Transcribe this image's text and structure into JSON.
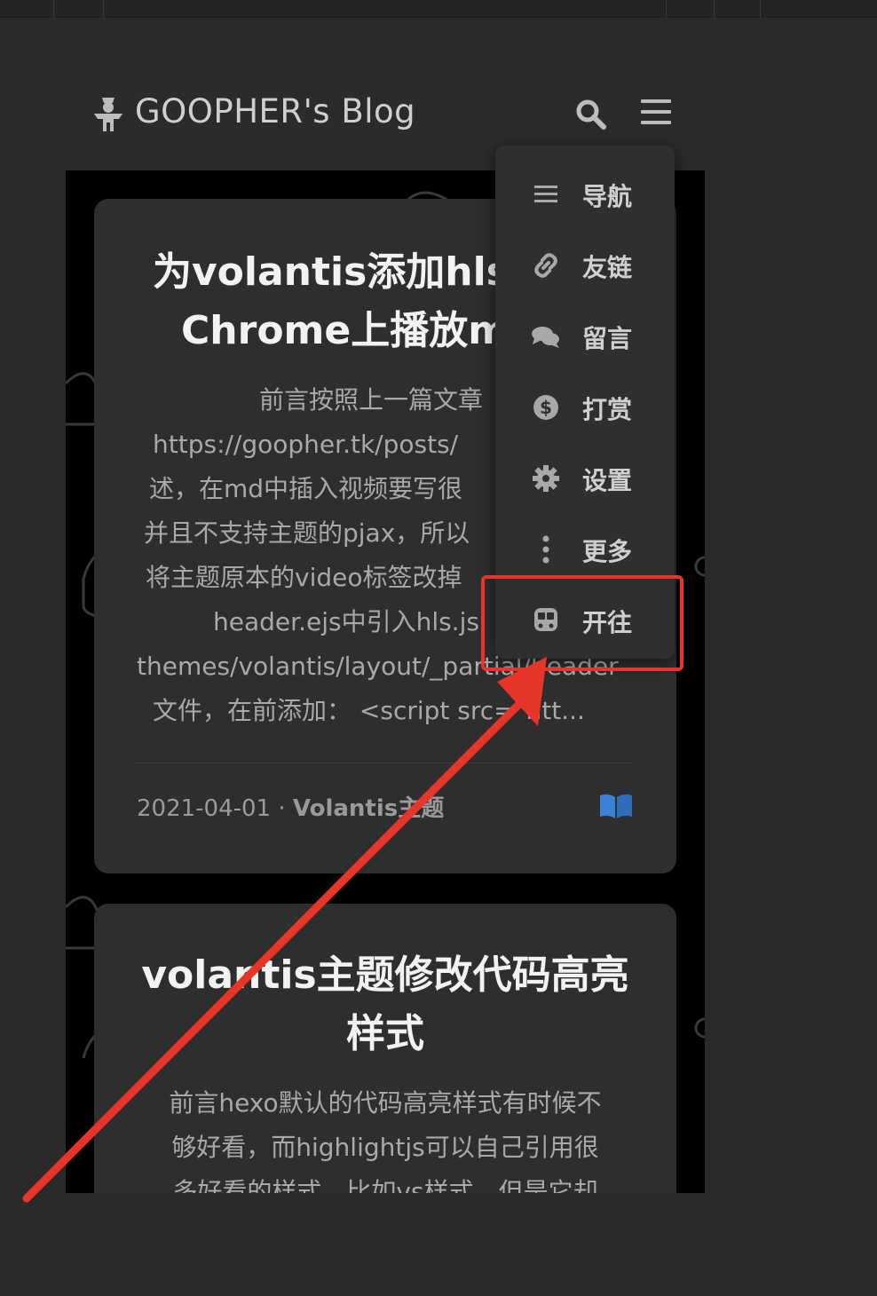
{
  "header": {
    "site_title": "GOOPHER's Blog",
    "logo_icon": "scarecrow-logo-icon",
    "search_icon": "search-icon",
    "menu_icon": "hamburger-menu-icon"
  },
  "posts": [
    {
      "title_lines": [
        "为volantis添加hls.js支持",
        "Chrome上播放m3u8"
      ],
      "excerpt_lines": [
        "前言按照上一篇文章",
        "https://goopher.tk/posts/",
        "述，在md中插入视频要写很",
        "并且不支持主题的pjax，所以",
        "将主题原本的video标签改掉",
        "header.ejs中引入hls.js",
        "themes/volantis/layout/_partial/header",
        "文件，在前添加： <script src=\"htt..."
      ],
      "date": "2021-04-01",
      "separator": "·",
      "category": "Volantis主题",
      "read_icon": "open-book-icon"
    },
    {
      "title_lines": [
        "volantis主题修改代码高亮",
        "样式"
      ],
      "excerpt_lines": [
        "前言hexo默认的代码高亮样式有时候不",
        "够好看，而highlightjs可以自己引用很",
        "多好看的样式，比如vs样式，但是它却"
      ]
    }
  ],
  "dropdown_menu": {
    "items": [
      {
        "label": "导航",
        "icon": "list-icon"
      },
      {
        "label": "友链",
        "icon": "link-icon"
      },
      {
        "label": "留言",
        "icon": "comments-icon"
      },
      {
        "label": "打赏",
        "icon": "dollar-icon"
      },
      {
        "label": "设置",
        "icon": "gear-icon"
      },
      {
        "label": "更多",
        "icon": "more-vertical-icon"
      },
      {
        "label": "开往",
        "icon": "train-icon"
      }
    ],
    "highlighted_item": "开往"
  },
  "annotation": {
    "highlight_color": "#e8352a",
    "arrow_color": "#e8352a"
  },
  "colors": {
    "page_bg": "#2a2a2a",
    "header_bg": "#2b2b2b",
    "card_bg": "#2e2e2e",
    "dropdown_bg": "#2f2f2f",
    "title_text": "#f2f2f2",
    "body_text": "#a9a9a9",
    "book_icon": "#3b82d6"
  }
}
